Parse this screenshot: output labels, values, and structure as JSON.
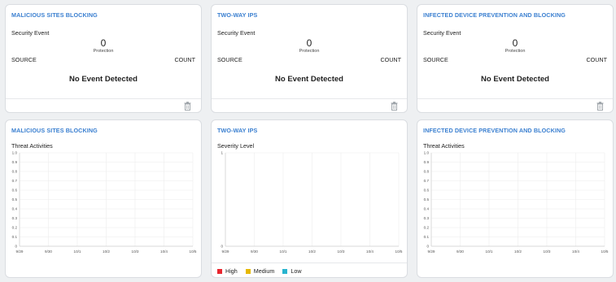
{
  "summary_cards": [
    {
      "title": "MALICIOUS SITES BLOCKING",
      "section_label": "Security Event",
      "count_value": "0",
      "count_caption": "Protection",
      "col_source": "SOURCE",
      "col_count": "COUNT",
      "empty_message": "No Event Detected",
      "footer_icon": "trash-icon"
    },
    {
      "title": "TWO-WAY IPS",
      "section_label": "Security Event",
      "count_value": "0",
      "count_caption": "Protection",
      "col_source": "SOURCE",
      "col_count": "COUNT",
      "empty_message": "No Event Detected",
      "footer_icon": "trash-icon"
    },
    {
      "title": "INFECTED DEVICE PREVENTION AND BLOCKING",
      "section_label": "Security Event",
      "count_value": "0",
      "count_caption": "Protection",
      "col_source": "SOURCE",
      "col_count": "COUNT",
      "empty_message": "No Event Detected",
      "footer_icon": "trash-icon"
    }
  ],
  "chart_cards": [
    {
      "title": "MALICIOUS SITES BLOCKING",
      "section_label": "Threat Activities"
    },
    {
      "title": "TWO-WAY IPS",
      "section_label": "Severity Level",
      "legend": [
        {
          "label": "High",
          "color": "#e8262f"
        },
        {
          "label": "Medium",
          "color": "#e6b800"
        },
        {
          "label": "Low",
          "color": "#28b4cf"
        }
      ]
    },
    {
      "title": "INFECTED DEVICE PREVENTION AND BLOCKING",
      "section_label": "Threat Activities"
    }
  ],
  "chart_data": [
    {
      "type": "line",
      "x": [
        "9/29",
        "9/30",
        "10/1",
        "10/2",
        "10/3",
        "10/4",
        "10/5"
      ],
      "y_ticks": [
        "1.0",
        "0.9",
        "0.8",
        "0.7",
        "0.6",
        "0.5",
        "0.4",
        "0.3",
        "0.2",
        "0.1",
        "0"
      ],
      "ylim": [
        0,
        1
      ],
      "grid": true,
      "series": []
    },
    {
      "type": "line",
      "x": [
        "9/29",
        "9/30",
        "10/1",
        "10/2",
        "10/3",
        "10/4",
        "10/5"
      ],
      "y_ticks": [
        "1",
        "0"
      ],
      "ylim": [
        0,
        1
      ],
      "grid": true,
      "series": []
    },
    {
      "type": "line",
      "x": [
        "9/29",
        "9/30",
        "10/1",
        "10/2",
        "10/3",
        "10/4",
        "10/5"
      ],
      "y_ticks": [
        "1.0",
        "0.9",
        "0.8",
        "0.7",
        "0.6",
        "0.5",
        "0.4",
        "0.3",
        "0.2",
        "0.1",
        "0"
      ],
      "ylim": [
        0,
        1
      ],
      "grid": true,
      "series": []
    }
  ]
}
